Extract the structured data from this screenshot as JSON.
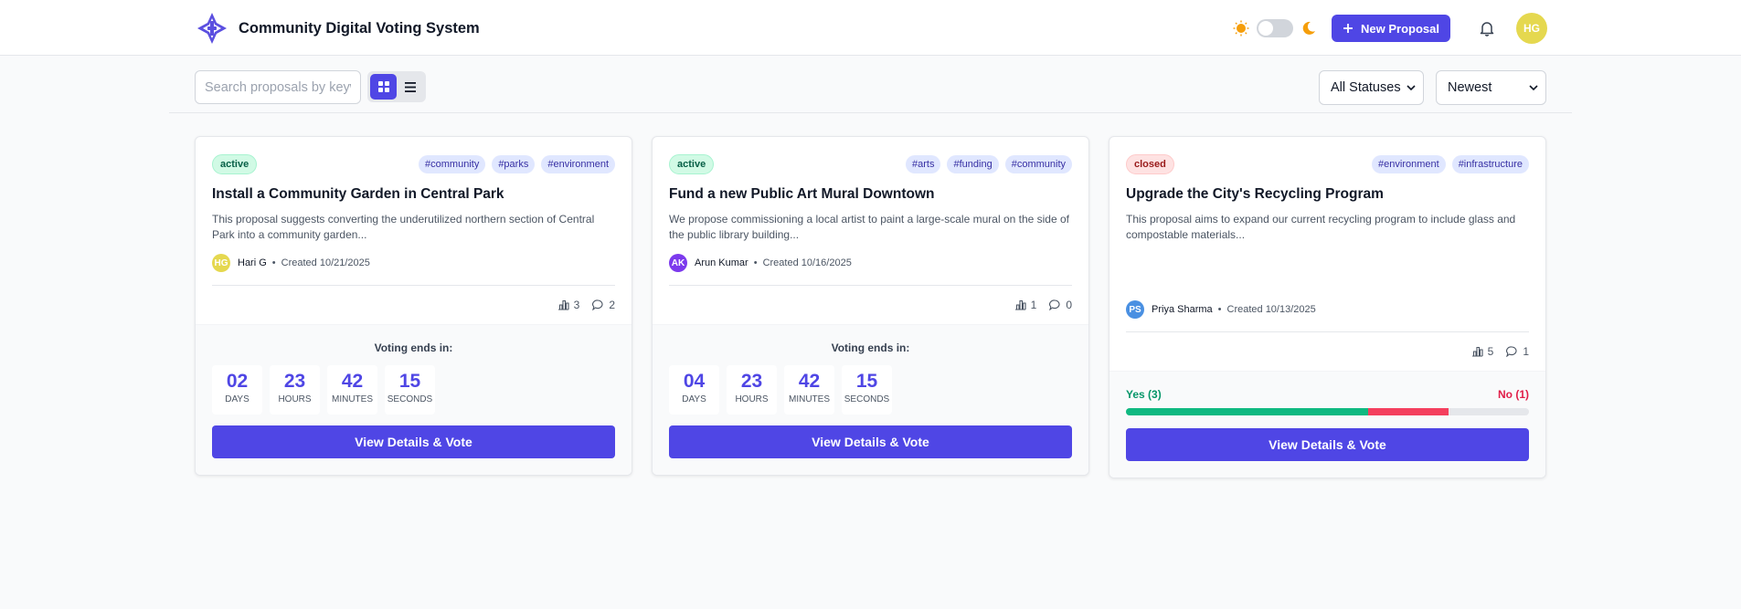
{
  "header": {
    "title": "Community Digital Voting System",
    "new_proposal": "New Proposal",
    "user_initials": "HG"
  },
  "toolbar": {
    "search_placeholder": "Search proposals by keyword...",
    "status_filter": "All Statuses",
    "sort": "Newest"
  },
  "cards": [
    {
      "status": "active",
      "tags": [
        "#community",
        "#parks",
        "#environment"
      ],
      "title": "Install a Community Garden in Central Park",
      "description": "This proposal suggests converting the underutilized northern section of Central Park into a community garden...",
      "author_initials": "HG",
      "author_color": "#e5d84f",
      "author": "Hari G",
      "created": "Created 10/21/2025",
      "votes": "3",
      "comments": "2",
      "ends_label": "Voting ends in:",
      "countdown": [
        {
          "value": "02",
          "label": "DAYS"
        },
        {
          "value": "23",
          "label": "HOURS"
        },
        {
          "value": "42",
          "label": "MINUTES"
        },
        {
          "value": "15",
          "label": "SECONDS"
        }
      ],
      "button": "View Details & Vote"
    },
    {
      "status": "active",
      "tags": [
        "#arts",
        "#funding",
        "#community"
      ],
      "title": "Fund a new Public Art Mural Downtown",
      "description": "We propose commissioning a local artist to paint a large-scale mural on the side of the public library building...",
      "author_initials": "AK",
      "author_color": "#7c3aed",
      "author": "Arun Kumar",
      "created": "Created 10/16/2025",
      "votes": "1",
      "comments": "0",
      "ends_label": "Voting ends in:",
      "countdown": [
        {
          "value": "04",
          "label": "DAYS"
        },
        {
          "value": "23",
          "label": "HOURS"
        },
        {
          "value": "42",
          "label": "MINUTES"
        },
        {
          "value": "15",
          "label": "SECONDS"
        }
      ],
      "button": "View Details & Vote"
    },
    {
      "status": "closed",
      "tags": [
        "#environment",
        "#infrastructure"
      ],
      "title": "Upgrade the City's Recycling Program",
      "description": "This proposal aims to expand our current recycling program to include glass and compostable materials...",
      "author_initials": "PS",
      "author_color": "#4a90e2",
      "author": "Priya Sharma",
      "created": "Created 10/13/2025",
      "votes": "5",
      "comments": "1",
      "yes_label": "Yes (3)",
      "no_label": "No (1)",
      "yes_fraction": 0.6,
      "no_fraction": 0.2,
      "button": "View Details & Vote"
    }
  ]
}
